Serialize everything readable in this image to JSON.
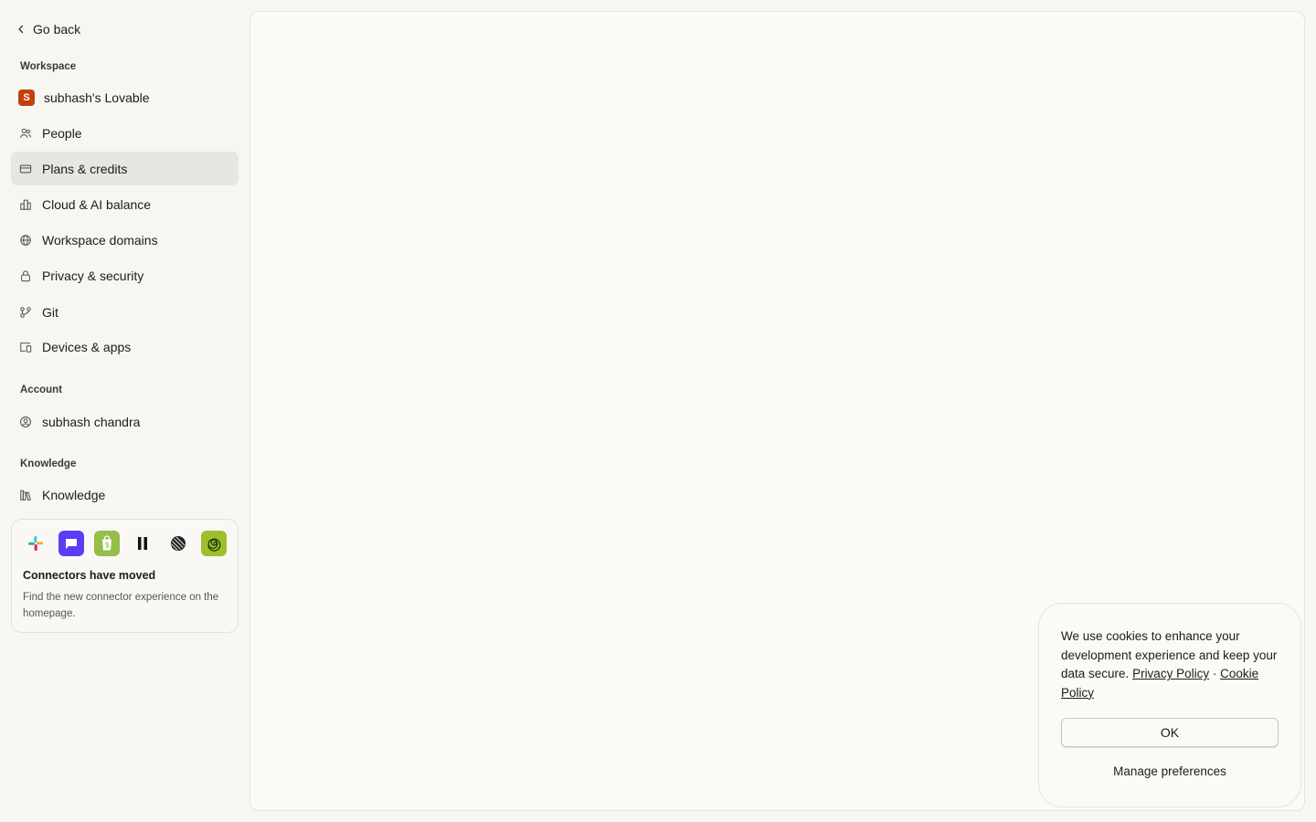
{
  "sidebar": {
    "go_back": "Go back",
    "workspace_label": "Workspace",
    "workspace_items": [
      {
        "label": "subhash's Lovable",
        "badge": "S"
      },
      {
        "label": "People"
      },
      {
        "label": "Plans & credits"
      },
      {
        "label": "Cloud & AI balance"
      },
      {
        "label": "Workspace domains"
      },
      {
        "label": "Privacy & security"
      },
      {
        "label": "Git"
      },
      {
        "label": "Devices & apps"
      }
    ],
    "active_item": "Plans & credits",
    "account_label": "Account",
    "account_items": [
      {
        "label": "subhash chandra"
      }
    ],
    "knowledge_label": "Knowledge",
    "knowledge_items": [
      {
        "label": "Knowledge"
      }
    ],
    "connectors_card": {
      "title": "Connectors have moved",
      "description": "Find the new connector experience on the homepage.",
      "logos": [
        "slack-logo",
        "chat-app-logo",
        "shopify-logo",
        "pause-app-logo",
        "linear-logo",
        "spiral-app-logo"
      ]
    }
  },
  "cookie_banner": {
    "text": "We use cookies to enhance your development experience and keep your data secure.",
    "privacy_link": "Privacy Policy",
    "separator": "·",
    "cookie_link": "Cookie Policy",
    "ok_label": "OK",
    "manage_label": "Manage preferences"
  },
  "colors": {
    "background": "#f7f6f2",
    "active_item_bg": "#e8e6e1",
    "workspace_badge": "#c2410c"
  }
}
